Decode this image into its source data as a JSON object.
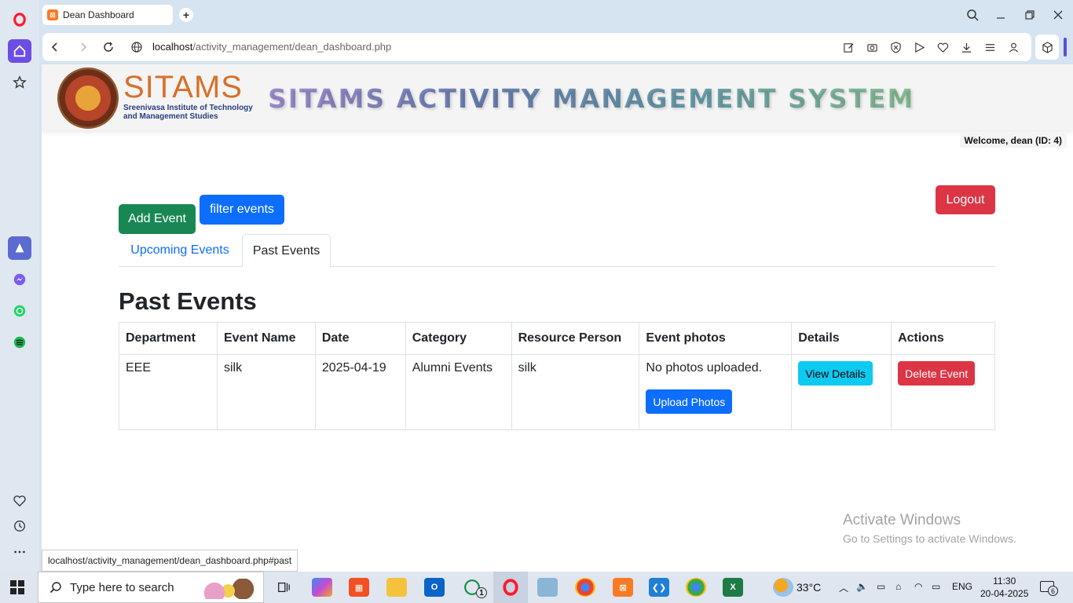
{
  "browser": {
    "tab_title": "Dean Dashboard",
    "tab_favicon": "xampp-icon",
    "url_host": "localhost",
    "url_path": "/activity_management/dean_dashboard.php",
    "status_url": "localhost/activity_management/dean_dashboard.php#past"
  },
  "header": {
    "brand_name": "SITAMS",
    "brand_sub_1": "Sreenivasa Institute of Technology",
    "brand_sub_2": "and Management Studies",
    "system_title": "SITAMS ACTIVITY MANAGEMENT SYSTEM"
  },
  "user": {
    "welcome": "Welcome, dean (ID: 4)"
  },
  "actions": {
    "add_event": "Add Event",
    "filter_events": "filter events",
    "logout": "Logout"
  },
  "tabs": {
    "upcoming": "Upcoming Events",
    "past": "Past Events",
    "active": "past"
  },
  "section_title": "Past Events",
  "table": {
    "headers": [
      "Department",
      "Event Name",
      "Date",
      "Category",
      "Resource Person",
      "Event photos",
      "Details",
      "Actions"
    ],
    "rows": [
      {
        "department": "EEE",
        "event_name": "silk",
        "date": "2025-04-19",
        "category": "Alumni Events",
        "resource_person": "silk",
        "photos_status": "No photos uploaded.",
        "upload_label": "Upload Photos",
        "view_label": "View Details",
        "delete_label": "Delete Event"
      }
    ]
  },
  "watermark": {
    "line1": "Activate Windows",
    "line2": "Go to Settings to activate Windows."
  },
  "taskbar": {
    "search_placeholder": "Type here to search",
    "weather": "33°C",
    "language": "ENG",
    "time": "11:30",
    "date": "20-04-2025",
    "whatsapp_badge": "1",
    "notifications": "6"
  },
  "colors": {
    "success": "#198754",
    "primary": "#0d6efd",
    "danger": "#dc3545",
    "info": "#0dcaf0",
    "opera_red": "#ff1b2d",
    "brand_orange": "#d8702a"
  }
}
